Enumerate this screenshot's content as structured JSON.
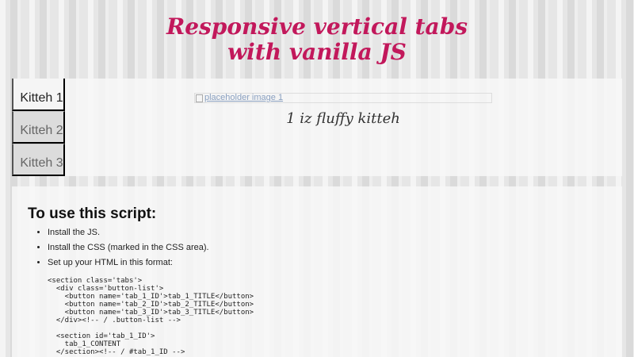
{
  "header": {
    "title_line1": "Responsive vertical tabs",
    "title_line2": "with vanilla JS"
  },
  "tabs": [
    {
      "label": "Kitteh 1",
      "active": true
    },
    {
      "label": "Kitteh 2",
      "active": false
    },
    {
      "label": "Kitteh 3",
      "active": false
    }
  ],
  "active_panel": {
    "image_alt": "placeholder image 1",
    "caption": "1 iz fluffy kitteh"
  },
  "instructions": {
    "heading": "To use this script:",
    "steps": [
      "Install the JS.",
      "Install the CSS (marked in the CSS area).",
      "Set up your HTML in this format:"
    ],
    "code_lines": [
      "<section class='tabs'>",
      "  <div class='button-list'>",
      "    <button name='tab_1_ID'>tab_1_TITLE</button>",
      "    <button name='tab_2_ID'>tab_2_TITLE</button>",
      "    <button name='tab_3_ID'>tab_3_TITLE</button>",
      "  </div><!-- / .button-list -->",
      "",
      "  <section id='tab_1_ID'>",
      "    tab_1_CONTENT",
      "  </section><!-- / #tab_1_ID -->"
    ]
  },
  "colors": {
    "title": "#c2185b",
    "background": "#e6e6e6",
    "panel": "#f8f8f8",
    "tab_inactive": "#dcdcdc"
  }
}
